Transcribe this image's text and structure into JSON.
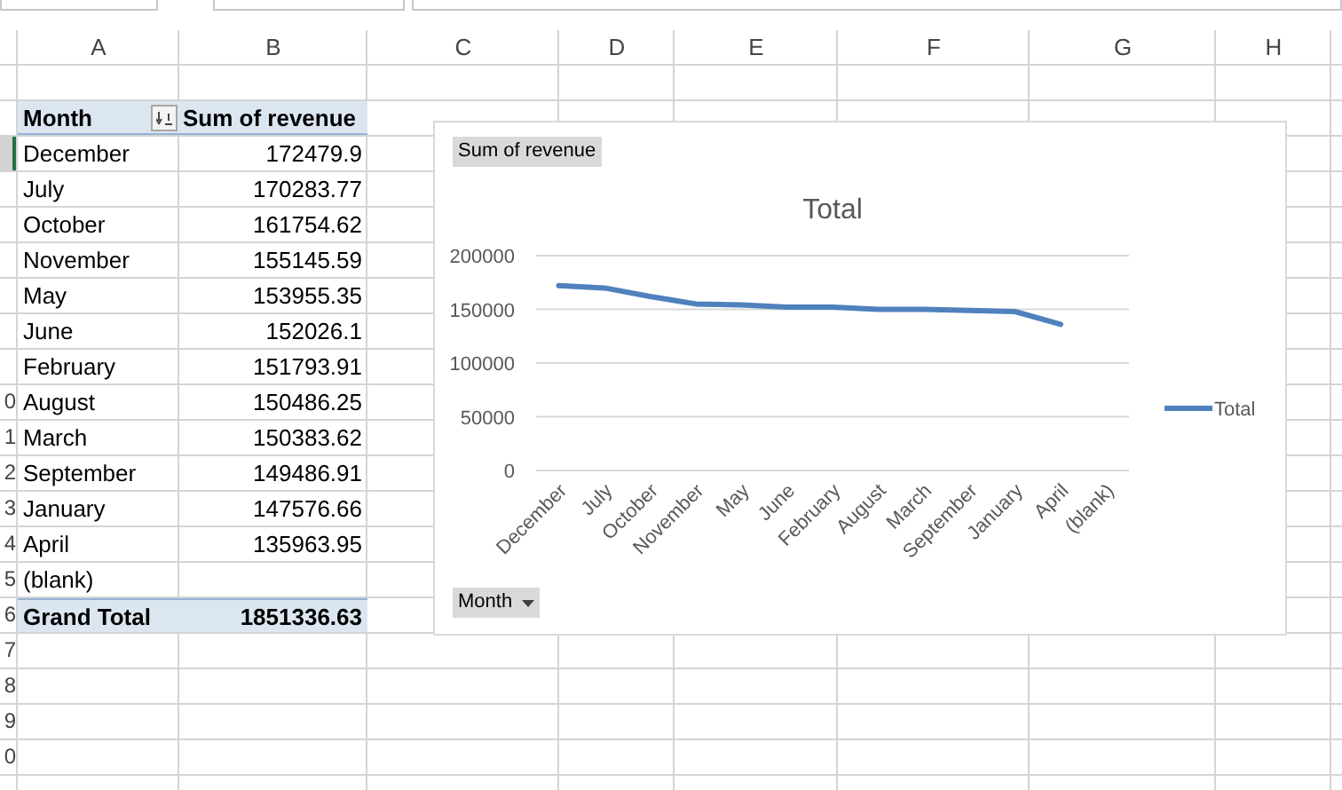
{
  "column_headers": [
    "A",
    "B",
    "C",
    "D",
    "E",
    "F",
    "G",
    "H"
  ],
  "row_numbers": [
    "0",
    "1",
    "2",
    "3",
    "4",
    "5",
    "6",
    "7",
    "8",
    "9",
    "0"
  ],
  "pivot": {
    "row_label": "Month",
    "value_label": "Sum of revenue",
    "rows": [
      {
        "month": "December",
        "value": "172479.9",
        "selected": true
      },
      {
        "month": "July",
        "value": "170283.77",
        "selected": false
      },
      {
        "month": "October",
        "value": "161754.62",
        "selected": false
      },
      {
        "month": "November",
        "value": "155145.59",
        "selected": false
      },
      {
        "month": "May",
        "value": "153955.35",
        "selected": false
      },
      {
        "month": "June",
        "value": "152026.1",
        "selected": false
      },
      {
        "month": "February",
        "value": "151793.91",
        "selected": false
      },
      {
        "month": "August",
        "value": "150486.25",
        "selected": false
      },
      {
        "month": "March",
        "value": "150383.62",
        "selected": false
      },
      {
        "month": "September",
        "value": "149486.91",
        "selected": false
      },
      {
        "month": "January",
        "value": "147576.66",
        "selected": false
      },
      {
        "month": "April",
        "value": "135963.95",
        "selected": false
      },
      {
        "month": "(blank)",
        "selected": false
      }
    ],
    "grand_total": {
      "label": "Grand Total",
      "value": "1851336.63"
    }
  },
  "chart": {
    "value_field_button": "Sum of revenue",
    "axis_field_button": "Month",
    "chart_data": {
      "type": "line",
      "title": "Total",
      "categories": [
        "December",
        "July",
        "October",
        "November",
        "May",
        "June",
        "February",
        "August",
        "March",
        "September",
        "January",
        "April",
        "(blank)"
      ],
      "series": [
        {
          "name": "Total",
          "color": "#4f81bd",
          "values": [
            172000,
            170000,
            162000,
            155000,
            154000,
            152000,
            152000,
            150000,
            150000,
            149000,
            148000,
            136000,
            null
          ]
        }
      ],
      "grid": true,
      "ylim": [
        0,
        200000
      ],
      "yticks": [
        0,
        50000,
        100000,
        150000,
        200000
      ]
    }
  }
}
